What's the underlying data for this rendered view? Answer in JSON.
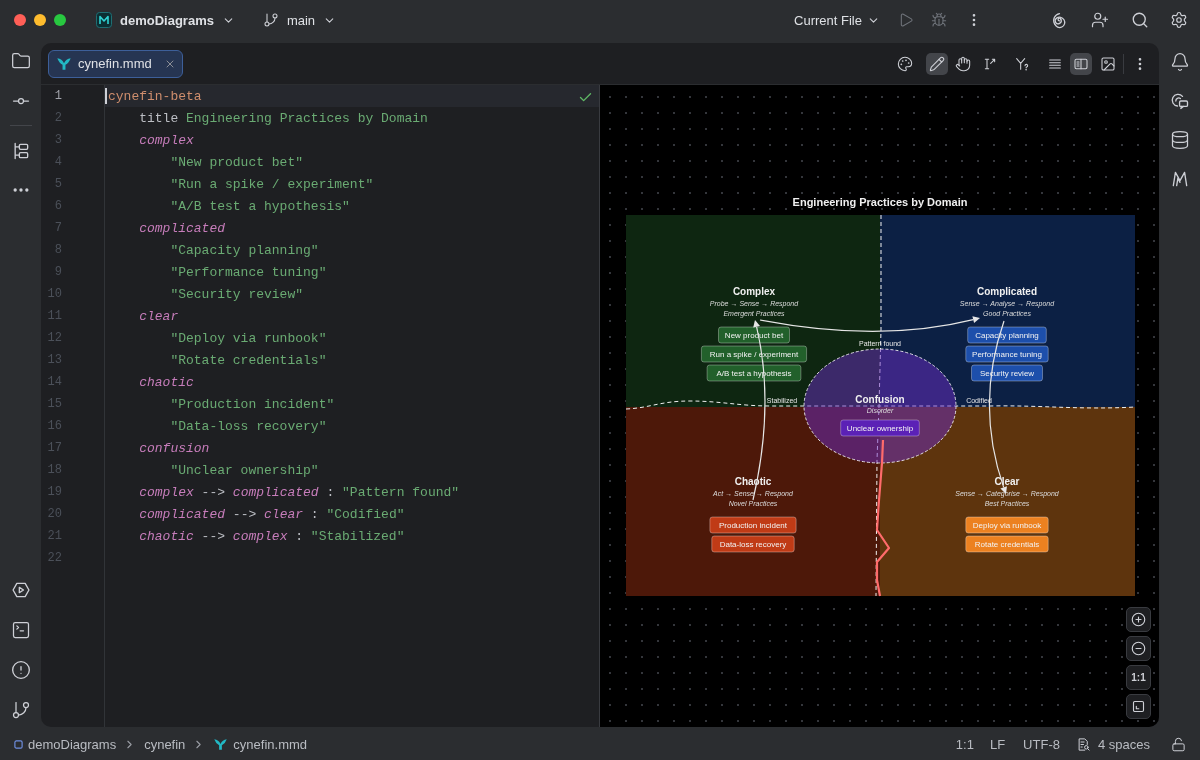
{
  "title_bar": {
    "project": "demoDiagrams",
    "branch": "main",
    "run_configuration": "Current File",
    "run_disabled": true
  },
  "editor_tabs": [
    {
      "label": "cynefin.mmd",
      "selected": true
    }
  ],
  "preview_toolbar": {
    "modes": [
      {
        "selected": true
      },
      {
        "selected": false
      },
      {
        "selected": false
      }
    ],
    "views": [
      {
        "selected": false
      },
      {
        "selected": true
      },
      {
        "selected": false
      }
    ]
  },
  "editor": {
    "gutter": [
      {
        "number": "1",
        "current": true
      },
      {
        "number": "2",
        "current": false
      },
      {
        "number": "3",
        "current": false
      },
      {
        "number": "4",
        "current": false
      },
      {
        "number": "5",
        "current": false
      },
      {
        "number": "6",
        "current": false
      },
      {
        "number": "7",
        "current": false
      },
      {
        "number": "8",
        "current": false
      },
      {
        "number": "9",
        "current": false
      },
      {
        "number": "10",
        "current": false
      },
      {
        "number": "11",
        "current": false
      },
      {
        "number": "12",
        "current": false
      },
      {
        "number": "13",
        "current": false
      },
      {
        "number": "14",
        "current": false
      },
      {
        "number": "15",
        "current": false
      },
      {
        "number": "16",
        "current": false
      },
      {
        "number": "17",
        "current": false
      },
      {
        "number": "18",
        "current": false
      },
      {
        "number": "19",
        "current": false
      },
      {
        "number": "20",
        "current": false
      },
      {
        "number": "21",
        "current": false
      },
      {
        "number": "22",
        "current": false
      }
    ],
    "code": [
      {
        "tokens": [
          {
            "kind": "keyword",
            "text": "cynefin-beta"
          }
        ],
        "children": [
          {
            "tokens": [
              {
                "kind": "plain",
                "text": "title "
              },
              {
                "kind": "string",
                "text": "Engineering Practices by Domain"
              }
            ]
          },
          {
            "tokens": [
              {
                "kind": "domain",
                "text": "complex"
              }
            ],
            "children": [
              {
                "tokens": [
                  {
                    "kind": "string",
                    "text": "\"New product bet\""
                  }
                ]
              },
              {
                "tokens": [
                  {
                    "kind": "string",
                    "text": "\"Run a spike / experiment\""
                  }
                ]
              },
              {
                "tokens": [
                  {
                    "kind": "string",
                    "text": "\"A/B test a hypothesis\""
                  }
                ]
              }
            ]
          },
          {
            "tokens": [
              {
                "kind": "domain",
                "text": "complicated"
              }
            ],
            "children": [
              {
                "tokens": [
                  {
                    "kind": "string",
                    "text": "\"Capacity planning\""
                  }
                ]
              },
              {
                "tokens": [
                  {
                    "kind": "string",
                    "text": "\"Performance tuning\""
                  }
                ]
              },
              {
                "tokens": [
                  {
                    "kind": "string",
                    "text": "\"Security review\""
                  }
                ]
              }
            ]
          },
          {
            "tokens": [
              {
                "kind": "domain",
                "text": "clear"
              }
            ],
            "children": [
              {
                "tokens": [
                  {
                    "kind": "string",
                    "text": "\"Deploy via runbook\""
                  }
                ]
              },
              {
                "tokens": [
                  {
                    "kind": "string",
                    "text": "\"Rotate credentials\""
                  }
                ]
              }
            ]
          },
          {
            "tokens": [
              {
                "kind": "domain",
                "text": "chaotic"
              }
            ],
            "children": [
              {
                "tokens": [
                  {
                    "kind": "string",
                    "text": "\"Production incident\""
                  }
                ]
              },
              {
                "tokens": [
                  {
                    "kind": "string",
                    "text": "\"Data-loss recovery\""
                  }
                ]
              }
            ]
          },
          {
            "tokens": [
              {
                "kind": "domain",
                "text": "confusion"
              }
            ],
            "children": [
              {
                "tokens": [
                  {
                    "kind": "string",
                    "text": "\"Unclear ownership\""
                  }
                ]
              }
            ]
          },
          {
            "tokens": [
              {
                "kind": "domain",
                "text": "complex"
              },
              {
                "kind": "plain",
                "text": " --> "
              },
              {
                "kind": "domain",
                "text": "complicated"
              },
              {
                "kind": "plain",
                "text": " : "
              },
              {
                "kind": "string",
                "text": "\"Pattern found\""
              }
            ]
          },
          {
            "tokens": [
              {
                "kind": "domain",
                "text": "complicated"
              },
              {
                "kind": "plain",
                "text": " --> "
              },
              {
                "kind": "domain",
                "text": "clear"
              },
              {
                "kind": "plain",
                "text": " : "
              },
              {
                "kind": "string",
                "text": "\"Codified\""
              }
            ]
          },
          {
            "tokens": [
              {
                "kind": "domain",
                "text": "chaotic"
              },
              {
                "kind": "plain",
                "text": " --> "
              },
              {
                "kind": "domain",
                "text": "complex"
              },
              {
                "kind": "plain",
                "text": " : "
              },
              {
                "kind": "string",
                "text": "\"Stabilized\""
              }
            ]
          }
        ]
      }
    ]
  },
  "preview": {
    "title": "Engineering Practices by Domain",
    "domains": [
      {
        "name": "Complex",
        "approach": "Probe → Sense → Respond",
        "practice": "Emergent Practices",
        "color": "#22602b",
        "items": [
          "New product bet",
          "Run a spike / experiment",
          "A/B test a hypothesis"
        ]
      },
      {
        "name": "Complicated",
        "approach": "Sense → Analyse → Respond",
        "practice": "Good Practices",
        "color": "#1d4fab",
        "items": [
          "Capacity planning",
          "Performance tuning",
          "Security review"
        ]
      },
      {
        "name": "Chaotic",
        "approach": "Act → Sense → Respond",
        "practice": "Novel Practices",
        "color": "#c03b16",
        "items": [
          "Production incident",
          "Data-loss recovery"
        ]
      },
      {
        "name": "Clear",
        "approach": "Sense → Categorise → Respond",
        "practice": "Best Practices",
        "color": "#ec8120",
        "items": [
          "Deploy via runbook",
          "Rotate credentials"
        ]
      }
    ],
    "confusion": {
      "name": "Confusion",
      "approach": "Disorder",
      "items": [
        "Unclear ownership"
      ]
    },
    "transitions": [
      {
        "label": "Pattern found"
      },
      {
        "label": "Stabilized"
      },
      {
        "label": "Codified"
      }
    ],
    "zoom_controls": {
      "actual_size": "1:1"
    }
  },
  "status_bar": {
    "breadcrumbs": [
      "demoDiagrams",
      "cynefin",
      "cynefin.mmd"
    ],
    "caret_position": "1:1",
    "line_separator": "LF",
    "encoding": "UTF-8",
    "indent": "4 spaces"
  }
}
